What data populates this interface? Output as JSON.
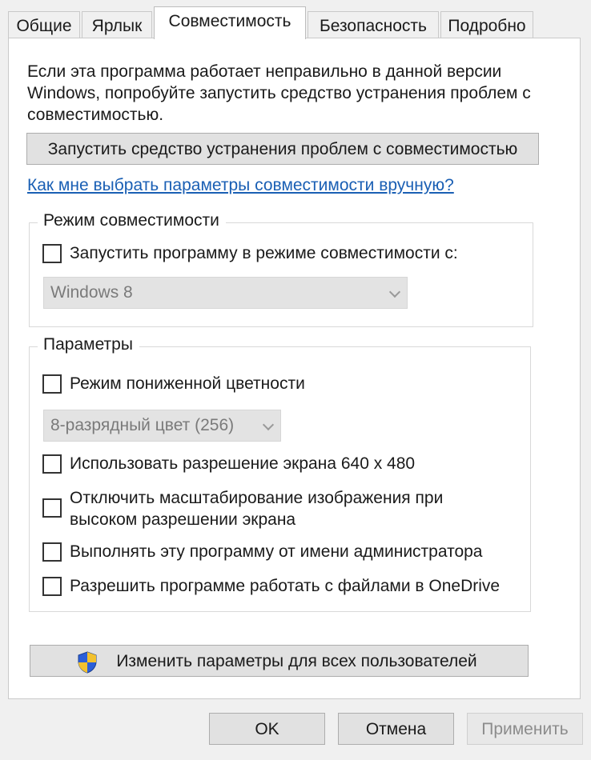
{
  "tabs": [
    {
      "label": "Общие"
    },
    {
      "label": "Ярлык"
    },
    {
      "label": "Совместимость"
    },
    {
      "label": "Безопасность"
    },
    {
      "label": "Подробно"
    }
  ],
  "intro_text": "Если эта программа работает неправильно в данной версии Windows, попробуйте запустить средство устранения проблем с совместимостью.",
  "troubleshoot_button": "Запустить средство устранения проблем с совместимостью",
  "help_link": "Как мне выбрать параметры совместимости вручную?",
  "compat_mode": {
    "legend": "Режим совместимости",
    "checkbox_label": "Запустить программу в режиме совместимости с:",
    "checked": false,
    "select_value": "Windows 8"
  },
  "settings": {
    "legend": "Параметры",
    "reduced_color_label": "Режим пониженной цветности",
    "color_select_value": "8-разрядный цвет (256)",
    "resolution_label": "Использовать разрешение экрана 640 x 480",
    "dpi_label_line1": "Отключить масштабирование изображения при",
    "dpi_label_line2": "высоком разрешении экрана",
    "admin_label": "Выполнять эту программу от имени администратора",
    "onedrive_label": "Разрешить программе работать с файлами в OneDrive"
  },
  "all_users_button": "Изменить параметры для всех пользователей",
  "footer": {
    "ok": "OK",
    "cancel": "Отмена",
    "apply": "Применить"
  },
  "colors": {
    "link": "#1a5fb4",
    "shield_blue": "#2b5fd9",
    "shield_yellow": "#f2c12e"
  }
}
